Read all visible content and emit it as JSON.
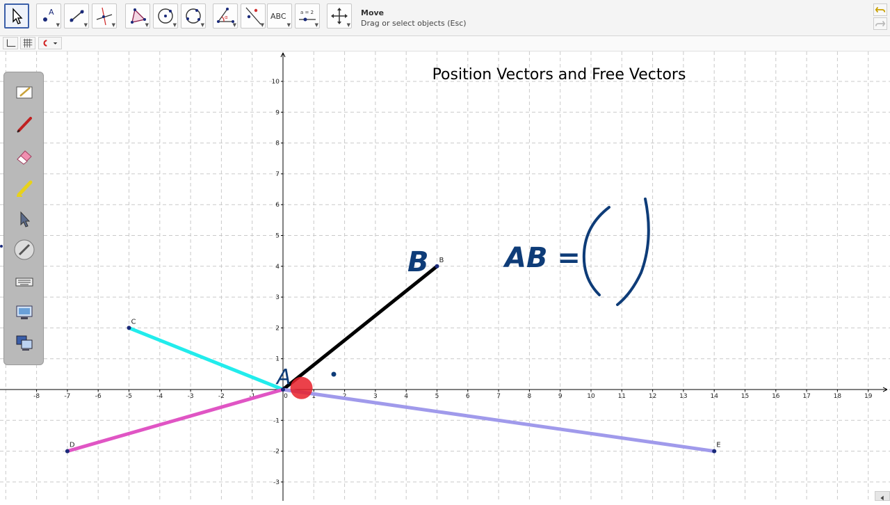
{
  "toolbar": {
    "tools": [
      {
        "name": "move-tool",
        "active": true
      },
      {
        "name": "point-tool",
        "label": "A"
      },
      {
        "name": "line-tool"
      },
      {
        "name": "perpendicular-line-tool"
      },
      {
        "name": "polygon-tool"
      },
      {
        "name": "circle-tool"
      },
      {
        "name": "circle-three-points-tool"
      },
      {
        "name": "angle-tool"
      },
      {
        "name": "reflect-tool"
      },
      {
        "name": "text-tool",
        "label": "ABC"
      },
      {
        "name": "slider-tool",
        "label": "a = 2"
      },
      {
        "name": "move-graphics-view-tool"
      }
    ],
    "active_tool_name": "Move",
    "active_tool_help": "Drag or select objects (Esc)"
  },
  "canvas": {
    "title": "Position Vectors and Free Vectors",
    "x_ticks": [
      "-8",
      "-7",
      "-6",
      "-5",
      "-4",
      "-3",
      "-2",
      "-1",
      "0",
      "1",
      "2",
      "3",
      "4",
      "5",
      "6",
      "7",
      "8",
      "9",
      "10",
      "11",
      "12",
      "13",
      "14",
      "15",
      "16",
      "17",
      "18",
      "19"
    ],
    "y_ticks": [
      "-3",
      "-2",
      "-1",
      "1",
      "2",
      "3",
      "4",
      "5",
      "6",
      "7",
      "8",
      "9",
      "10"
    ],
    "segments": [
      {
        "from": "A",
        "to": "B",
        "color": "#000000"
      },
      {
        "from": "A",
        "to": "C",
        "color": "#22ecec"
      },
      {
        "from": "A",
        "to": "D",
        "color": "#e055c4"
      },
      {
        "from": "A",
        "to": "E",
        "color": "#a09aeb"
      }
    ],
    "points": {
      "A": {
        "x": 0,
        "y": 0,
        "label": ""
      },
      "B": {
        "x": 5,
        "y": 4,
        "label": "B"
      },
      "C": {
        "x": -5,
        "y": 2,
        "label": "C"
      },
      "D": {
        "x": -7,
        "y": -2,
        "label": "D"
      },
      "E": {
        "x": 14,
        "y": -2,
        "label": "E"
      }
    },
    "handwriting": {
      "label_A": "A",
      "label_B": "B",
      "equation": "AB ="
    },
    "colors": {
      "grid": "#c9c9c9",
      "axis": "#000000",
      "ink": "#0e3c78",
      "highlight": "#e8202a"
    }
  }
}
